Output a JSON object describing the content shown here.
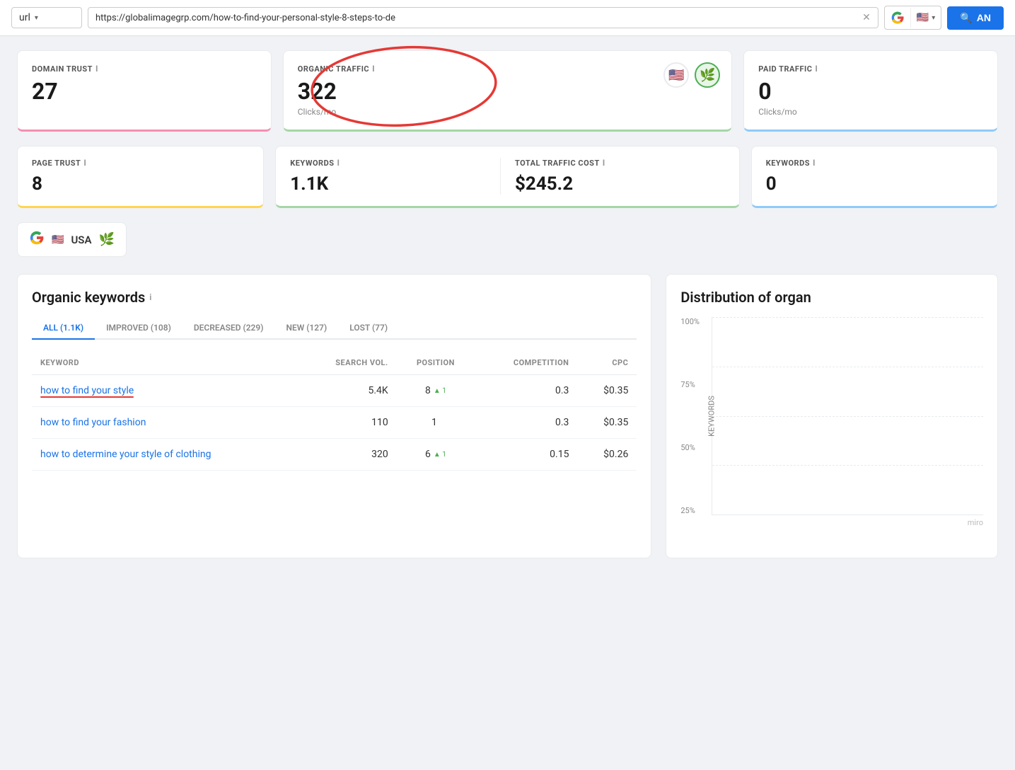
{
  "topbar": {
    "url_type": "url",
    "url_value": "https://globalimagegrp.com/how-to-find-your-personal-style-8-steps-to-de",
    "analyze_label": "AN",
    "chevron": "▾"
  },
  "metrics": {
    "domain_trust": {
      "label": "DOMAIN TRUST",
      "value": "27",
      "info": "i"
    },
    "organic_traffic": {
      "label": "ORGANIC TRAFFIC",
      "value": "322",
      "sub": "Clicks/mo",
      "info": "i"
    },
    "paid_traffic": {
      "label": "PAID TRAFFIC",
      "value": "0",
      "sub": "Clicks/mo",
      "info": "i"
    },
    "page_trust": {
      "label": "PAGE TRUST",
      "value": "8",
      "info": "i"
    },
    "keywords": {
      "label": "KEYWORDS",
      "value": "1.1K",
      "info": "i"
    },
    "total_traffic_cost": {
      "label": "TOTAL TRAFFIC COST",
      "value": "$245.2",
      "info": "i"
    },
    "paid_keywords": {
      "label": "KEYWORDS",
      "value": "0",
      "info": "i"
    }
  },
  "country_selector": {
    "google_label": "G",
    "country_label": "USA",
    "leaf": "🌿"
  },
  "organic_keywords": {
    "title": "Organic keywords",
    "info": "i",
    "tabs": [
      {
        "label": "ALL (1.1K)",
        "active": true
      },
      {
        "label": "IMPROVED (108)",
        "active": false
      },
      {
        "label": "DECREASED (229)",
        "active": false
      },
      {
        "label": "NEW (127)",
        "active": false
      },
      {
        "label": "LOST (77)",
        "active": false
      }
    ],
    "columns": [
      "KEYWORD",
      "SEARCH VOL.",
      "POSITION",
      "COMPETITION",
      "CPC"
    ],
    "rows": [
      {
        "keyword": "how to find your style",
        "search_vol": "5.4K",
        "position": "8",
        "position_change": "▲ 1",
        "competition": "0.3",
        "cpc": "$0.35",
        "underlined": true
      },
      {
        "keyword": "how to find your fashion",
        "search_vol": "110",
        "position": "1",
        "position_change": "",
        "competition": "0.3",
        "cpc": "$0.35",
        "underlined": false
      },
      {
        "keyword": "how to determine your style of clothing",
        "search_vol": "320",
        "position": "6",
        "position_change": "▲ 1",
        "competition": "0.15",
        "cpc": "$0.26",
        "underlined": false
      }
    ]
  },
  "distribution": {
    "title": "Distribution of organ",
    "y_labels": [
      "100%",
      "75%",
      "50%",
      "25%"
    ],
    "y_axis_label": "KEYWORDS",
    "miro_label": "miro"
  }
}
